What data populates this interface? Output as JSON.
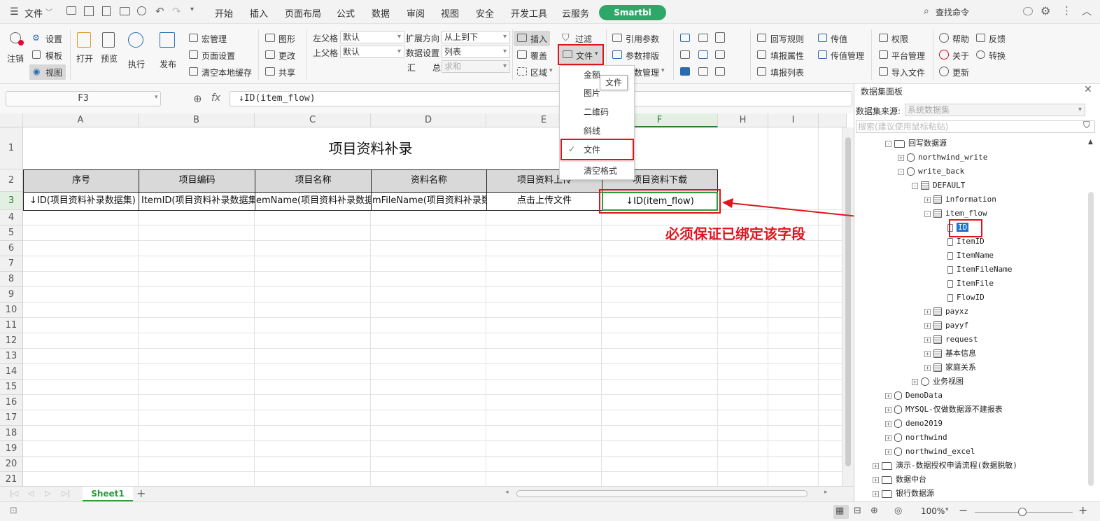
{
  "topbar": {
    "file_menu": "文件",
    "tabs": [
      "开始",
      "插入",
      "页面布局",
      "公式",
      "数据",
      "审阅",
      "视图",
      "安全",
      "开发工具",
      "云服务"
    ],
    "active_tab": "Smartbi",
    "search": "查找命令"
  },
  "ribbon": {
    "logout": "注销",
    "settings": "设置",
    "template": "模板",
    "view": "视图",
    "open": "打开",
    "preview": "预览",
    "execute": "执行",
    "publish": "发布",
    "macro": "宏管理",
    "page_setup": "页面设置",
    "clear_cache": "清空本地缓存",
    "chart": "图形",
    "change": "更改",
    "share": "共享",
    "left_parent_label": "左父格",
    "left_parent_value": "默认",
    "top_parent_label": "上父格",
    "top_parent_value": "默认",
    "expand_dir_label": "扩展方向",
    "expand_dir_value": "从上到下",
    "data_setting_label": "数据设置",
    "data_setting_value": "列表",
    "summary_label_1": "汇",
    "summary_label_2": "总",
    "summary_value": "求和",
    "insert": "插入",
    "cover": "覆盖",
    "region": "区域",
    "filter": "过滤",
    "file_btn": "文件",
    "ref_param": "引用参数",
    "param_layout": "参数排版",
    "param_manage": "数管理",
    "writeback_rule": "回写规则",
    "fill_attr": "填报属性",
    "fill_list": "填报列表",
    "pass_value": "传值",
    "pass_manage": "传值管理",
    "permission": "权限",
    "platform": "平台管理",
    "import_file": "导入文件",
    "help": "帮助",
    "about": "关于",
    "update": "更新",
    "feedback": "反馈",
    "convert": "转换"
  },
  "formula": {
    "cell_ref": "F3",
    "fx": "fx",
    "content": "↓ID(item_flow)"
  },
  "grid": {
    "columns": [
      "A",
      "B",
      "C",
      "D",
      "E",
      "F",
      "H",
      "I"
    ],
    "rows": [
      "1",
      "2",
      "3",
      "4",
      "5",
      "6",
      "7",
      "8",
      "9",
      "10",
      "11",
      "12",
      "13",
      "14",
      "15",
      "16",
      "17",
      "18",
      "19",
      "20",
      "21"
    ],
    "title": "项目资料补录",
    "headers": [
      "序号",
      "项目编码",
      "项目名称",
      "资料名称",
      "项目资料上传",
      "项目资料下载"
    ],
    "data_row": [
      "↓ID(项目资料补录数据集)",
      "ItemID(项目资料补录数据集",
      "emName(项目资料补录数据",
      "mFileName(项目资料补录数据",
      "点击上传文件",
      "↓ID(item_flow)"
    ]
  },
  "dropdown": {
    "items": [
      "金额",
      "图片",
      "二维码",
      "斜线",
      "文件",
      "清空格式"
    ],
    "checked": "文件",
    "tooltip": "文件"
  },
  "annotation": {
    "text": "必须保证已绑定该字段",
    "color": "#e0141e"
  },
  "panel": {
    "title": "数据集面板",
    "source_label": "数据集来源:",
    "source_value": "系统数据集",
    "search_placeholder": "搜索(建议使用鼠标粘贴)",
    "tree": [
      {
        "label": "回写数据源",
        "type": "folder",
        "level": 0,
        "exp": "-"
      },
      {
        "label": "northwind_write",
        "type": "db",
        "level": 1,
        "exp": "+"
      },
      {
        "label": "write_back",
        "type": "db",
        "level": 1,
        "exp": "-"
      },
      {
        "label": "DEFAULT",
        "type": "schema",
        "level": 2,
        "exp": "-"
      },
      {
        "label": "information",
        "type": "table",
        "level": 3,
        "exp": "+"
      },
      {
        "label": "item_flow",
        "type": "table",
        "level": 3,
        "exp": "-"
      },
      {
        "label": "ID",
        "type": "field",
        "level": 4,
        "exp": "",
        "selected": true
      },
      {
        "label": "ItemID",
        "type": "field",
        "level": 4,
        "exp": ""
      },
      {
        "label": "ItemName",
        "type": "field",
        "level": 4,
        "exp": ""
      },
      {
        "label": "ItemFileName",
        "type": "field",
        "level": 4,
        "exp": ""
      },
      {
        "label": "ItemFile",
        "type": "field",
        "level": 4,
        "exp": ""
      },
      {
        "label": "FlowID",
        "type": "field",
        "level": 4,
        "exp": ""
      },
      {
        "label": "payxz",
        "type": "table",
        "level": 3,
        "exp": "+"
      },
      {
        "label": "payyf",
        "type": "table",
        "level": 3,
        "exp": "+"
      },
      {
        "label": "request",
        "type": "table",
        "level": 3,
        "exp": "+"
      },
      {
        "label": "基本信息",
        "type": "table",
        "level": 3,
        "exp": "+"
      },
      {
        "label": "家庭关系",
        "type": "table",
        "level": 3,
        "exp": "+"
      },
      {
        "label": "业务视图",
        "type": "view",
        "level": 2,
        "exp": "+"
      },
      {
        "label": "DemoData",
        "type": "db",
        "level": 0,
        "exp": "+"
      },
      {
        "label": "MYSQL-仅做数据源不建报表",
        "type": "db",
        "level": 0,
        "exp": "+"
      },
      {
        "label": "demo2019",
        "type": "db",
        "level": 0,
        "exp": "+"
      },
      {
        "label": "northwind",
        "type": "db",
        "level": 0,
        "exp": "+"
      },
      {
        "label": "northwind_excel",
        "type": "db",
        "level": 0,
        "exp": "+"
      },
      {
        "label": "演示-数据授权申请流程(数据脱敏)",
        "type": "folder",
        "level": -1,
        "exp": "+"
      },
      {
        "label": "数据中台",
        "type": "folder",
        "level": -1,
        "exp": "+"
      },
      {
        "label": "银行数据源",
        "type": "folder",
        "level": -1,
        "exp": "+"
      }
    ]
  },
  "sheet": {
    "name": "Sheet1",
    "add": "+"
  },
  "status": {
    "zoom": "100%",
    "minus": "−",
    "plus": "+"
  }
}
